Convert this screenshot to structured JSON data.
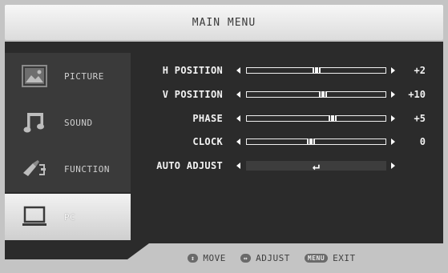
{
  "header": {
    "title": "MAIN MENU"
  },
  "sidebar": {
    "items": [
      {
        "label": "PICTURE",
        "icon": "picture-icon",
        "active": false
      },
      {
        "label": "SOUND",
        "icon": "music-note-icon",
        "active": false
      },
      {
        "label": "FUNCTION",
        "icon": "function-icon",
        "active": false
      },
      {
        "label": "PC",
        "icon": "monitor-icon",
        "active": true
      }
    ]
  },
  "settings": [
    {
      "name": "H POSITION",
      "value": "+2",
      "level": 0.5
    },
    {
      "name": "V POSITION",
      "value": "+10",
      "level": 0.55
    },
    {
      "name": "PHASE",
      "value": "+5",
      "level": 0.62
    },
    {
      "name": "CLOCK",
      "value": "0",
      "level": 0.46
    },
    {
      "name": "AUTO ADJUST",
      "value": "",
      "action_symbol": "↵"
    }
  ],
  "footer": {
    "move": {
      "key": "↕",
      "label": "MOVE"
    },
    "adjust": {
      "key": "↔",
      "label": "ADJUST"
    },
    "exit": {
      "key": "MENU",
      "label": "EXIT"
    }
  },
  "colors": {
    "panel": "#2b2b2b",
    "header": "#e6e6e6",
    "active_item": "#e0e0e0"
  }
}
